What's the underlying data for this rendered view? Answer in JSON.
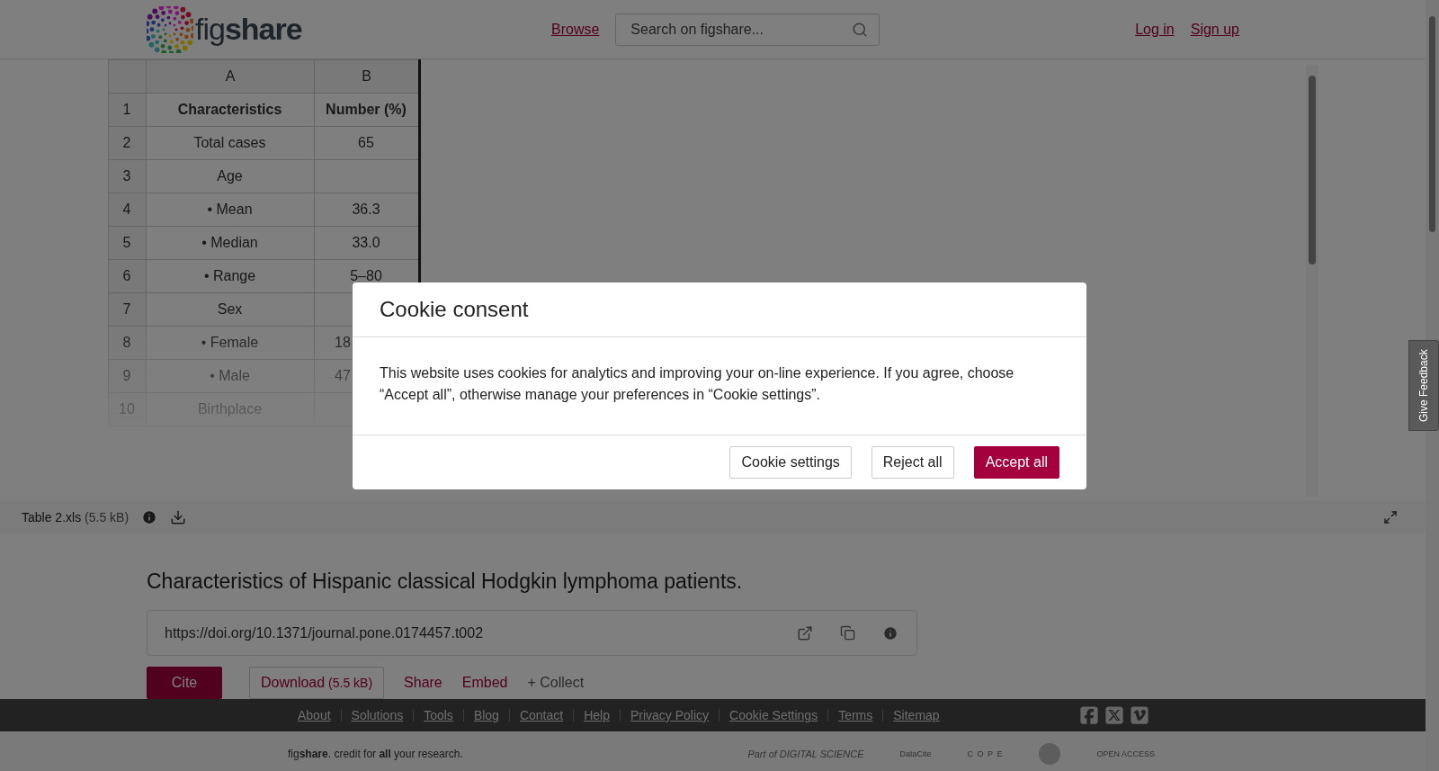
{
  "header": {
    "logo": "fig**share**",
    "nav_link": "Browse",
    "search": {
      "placeholder": "Search on figshare..."
    },
    "links": [
      "Log in",
      "Sign up"
    ]
  },
  "viewer": {
    "columns": [
      "A",
      "B"
    ],
    "rows": [
      {
        "number": "1",
        "kind": "heading",
        "cells": [
          "Characteristics",
          "Number (%)"
        ]
      },
      {
        "number": "2",
        "kind": "body",
        "cells": [
          "Total cases",
          "65"
        ]
      },
      {
        "number": "3",
        "kind": "body",
        "cells": [
          "Age",
          ""
        ]
      },
      {
        "number": "4",
        "kind": "body",
        "cells": [
          "• Mean",
          "36.3"
        ]
      },
      {
        "number": "5",
        "kind": "body",
        "cells": [
          "• Median",
          "33.0"
        ]
      },
      {
        "number": "6",
        "kind": "body",
        "cells": [
          "• Range",
          "5–80"
        ]
      },
      {
        "number": "7",
        "kind": "body",
        "cells": [
          "Sex",
          ""
        ]
      },
      {
        "number": "8",
        "kind": "clipped",
        "cells": [
          "• Female",
          "18"
        ]
      },
      {
        "number": "9",
        "kind": "clipped",
        "cells": [
          "• Male",
          "47"
        ]
      },
      {
        "number": "10",
        "kind": "body",
        "cells": [
          "Birthplace",
          ""
        ]
      }
    ],
    "file": {
      "name": "Table 2.xls",
      "size": "(5.5 kB)"
    }
  },
  "item": {
    "title": "Characteristics of Hispanic classical Hodgkin lymphoma patients.",
    "doi": "https://doi.org/10.1371/journal.pone.0174457.t002",
    "actions": [
      {
        "kind": "primary",
        "label": "Cite"
      },
      {
        "kind": "outline",
        "label": "Download",
        "detail": "(5.5 kB)"
      },
      {
        "kind": "link",
        "label": "Share"
      },
      {
        "kind": "link",
        "label": "Embed"
      },
      {
        "kind": "muted",
        "label": "+ Collect"
      }
    ]
  },
  "footer": {
    "links": [
      "About",
      "Solutions",
      "Tools",
      "Blog",
      "Contact",
      "Help",
      "Privacy Policy",
      "Cookie Settings",
      "Terms",
      "Sitemap"
    ],
    "tagline": "fig**share**. credit for **all** your research.",
    "partners": [
      "Part of DIGITAL SCIENCE",
      "DataCite",
      "C O P E",
      "OPEN ACCESS"
    ]
  },
  "feedback_tab": "Give Feedback",
  "cookie_dialog": {
    "title": "Cookie consent",
    "message": "This website uses cookies for analytics and improving your on-line experience. If you agree, choose “Accept all”, otherwise manage your preferences in “Cookie settings”.",
    "buttons": [
      {
        "kind": "secondary",
        "label": "Cookie settings"
      },
      {
        "kind": "secondary",
        "label": "Reject all"
      },
      {
        "kind": "primary",
        "label": "Accept all"
      }
    ]
  }
}
